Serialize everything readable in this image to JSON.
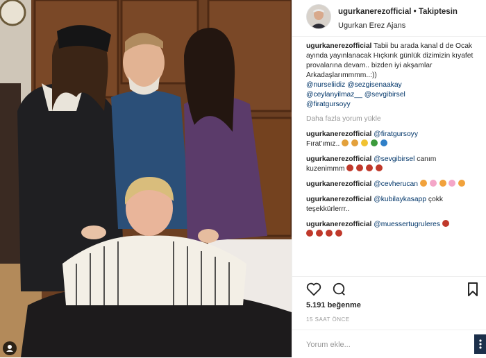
{
  "post": {
    "username": "ugurkanerezofficial",
    "separator": "•",
    "follow_status": "Takiptesin",
    "location": "Ugurkan Erez Ajans"
  },
  "caption": {
    "username": "ugurkanerezofficial",
    "text": "Tabii bu arada kanal d de Ocak ayında yayınlanacak Hıçkırık günlük dizimizin kıyafet provalarına devam.. bizden iyi akşamlar Arkadaşlarımmmm..:))",
    "mentions": [
      "@nurseliidiz",
      "@sezgisenaakay",
      "@ceylanyilmaz__",
      "@sevgibirsel",
      "@firatgursoyy"
    ]
  },
  "load_more": "Daha fazla yorum yükle",
  "comments": [
    {
      "user": "ugurkanerezofficial",
      "mention": "@firatgursoyy",
      "text": "Fırat'ımız.."
    },
    {
      "user": "ugurkanerezofficial",
      "mention": "@sevgibirsel",
      "text": "canım kuzenimmm"
    },
    {
      "user": "ugurkanerezofficial",
      "mention": "@cevherucan",
      "text": ""
    },
    {
      "user": "ugurkanerezofficial",
      "mention": "@kubilaykasapp",
      "text": "çokk teşekkürlerrr.."
    },
    {
      "user": "ugurkanerezofficial",
      "mention": "@muessertugruleres",
      "text": ""
    }
  ],
  "likes": "5.191 beğenme",
  "time_ago": "15 SAAT ÖNCE",
  "comment_placeholder": "Yorum ekle...",
  "icons": {
    "like": "heart-icon",
    "comment": "comment-icon",
    "save": "bookmark-icon",
    "options": "more-icon"
  },
  "colors": {
    "text": "#262626",
    "muted": "#999999",
    "link": "#003569",
    "border": "#efefef"
  }
}
